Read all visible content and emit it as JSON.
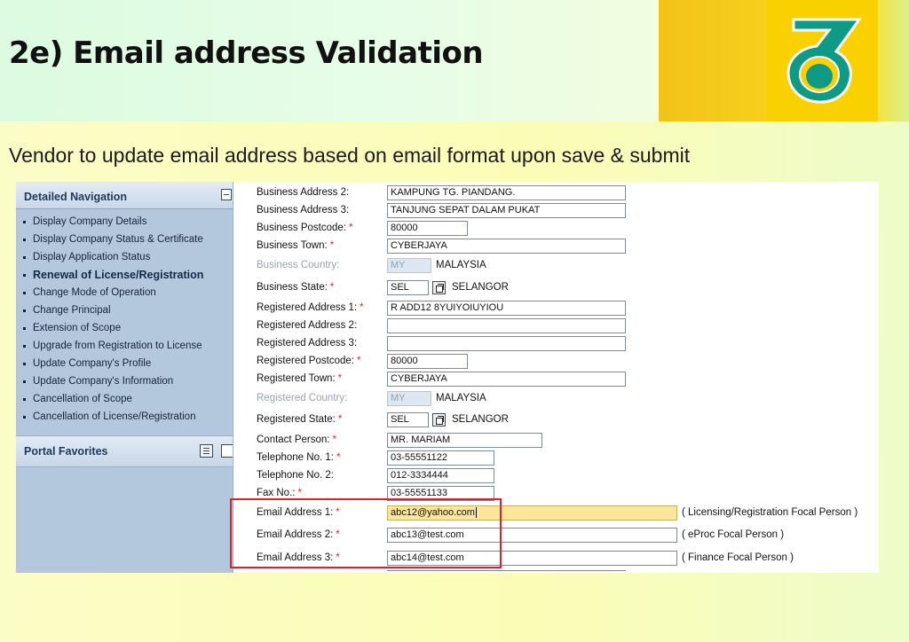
{
  "slide": {
    "title": "2e) Email address Validation",
    "subtitle": "Vendor to update email address based on email format upon save & submit",
    "logo_icon": "petronas-logo-icon"
  },
  "colors": {
    "logo_teal": "#0e9a85",
    "nav_bg": "#b4c8dd",
    "required_star": "#e0261f",
    "highlight_field": "#fbe69b",
    "callout_border": "#d9232f"
  },
  "nav": {
    "heading": "Detailed Navigation",
    "items": [
      {
        "label": "Display Company Details"
      },
      {
        "label": "Display Company Status & Certificate"
      },
      {
        "label": "Display Application Status"
      },
      {
        "label": "Renewal of License/Registration",
        "active": true
      },
      {
        "label": "Change Mode of Operation"
      },
      {
        "label": "Change Principal"
      },
      {
        "label": "Extension of Scope"
      },
      {
        "label": "Upgrade from Registration to License"
      },
      {
        "label": "Update Company's Profile"
      },
      {
        "label": "Update Company's Information"
      },
      {
        "label": "Cancellation of Scope"
      },
      {
        "label": "Cancellation of License/Registration"
      }
    ],
    "favorites_heading": "Portal Favorites"
  },
  "form": {
    "required_mark": "*",
    "business_address_2": {
      "label": "Business Address 2:",
      "value": "KAMPUNG TG. PIANDANG."
    },
    "business_address_3": {
      "label": "Business Address 3:",
      "value": "TANJUNG SEPAT DALAM PUKAT"
    },
    "business_postcode": {
      "label": "Business Postcode:",
      "value": "80000"
    },
    "business_town": {
      "label": "Business Town:",
      "value": "CYBERJAYA"
    },
    "business_country": {
      "label": "Business Country:",
      "code": "MY",
      "name": "MALAYSIA"
    },
    "business_state": {
      "label": "Business State:",
      "code": "SEL",
      "name": "SELANGOR"
    },
    "registered_address_1": {
      "label": "Registered Address 1:",
      "value": "R ADD12 8YUIYOIUYIOU"
    },
    "registered_address_2": {
      "label": "Registered Address 2:",
      "value": ""
    },
    "registered_address_3": {
      "label": "Registered Address 3:",
      "value": ""
    },
    "registered_postcode": {
      "label": "Registered Postcode:",
      "value": "80000"
    },
    "registered_town": {
      "label": "Registered Town:",
      "value": "CYBERJAYA"
    },
    "registered_country": {
      "label": "Registered Country:",
      "code": "MY",
      "name": "MALAYSIA"
    },
    "registered_state": {
      "label": "Registered State:",
      "code": "SEL",
      "name": "SELANGOR"
    },
    "contact_person": {
      "label": "Contact Person:",
      "value": "MR. MARIAM"
    },
    "telephone_1": {
      "label": "Telephone No. 1:",
      "value": "03-55551122"
    },
    "telephone_2": {
      "label": "Telephone No. 2:",
      "value": "012-3334444"
    },
    "fax": {
      "label": "Fax No.:",
      "value": "03-55551133"
    },
    "email_1": {
      "label": "Email Address 1:",
      "value": "abc12@yahoo.com",
      "note": "( Licensing/Registration Focal Person )"
    },
    "email_2": {
      "label": "Email Address 2:",
      "value": "abc13@test.com",
      "note": "( eProc Focal Person )"
    },
    "email_3": {
      "label": "Email Address 3:",
      "value": "abc14@test.com",
      "note": "( Finance Focal Person )"
    }
  }
}
